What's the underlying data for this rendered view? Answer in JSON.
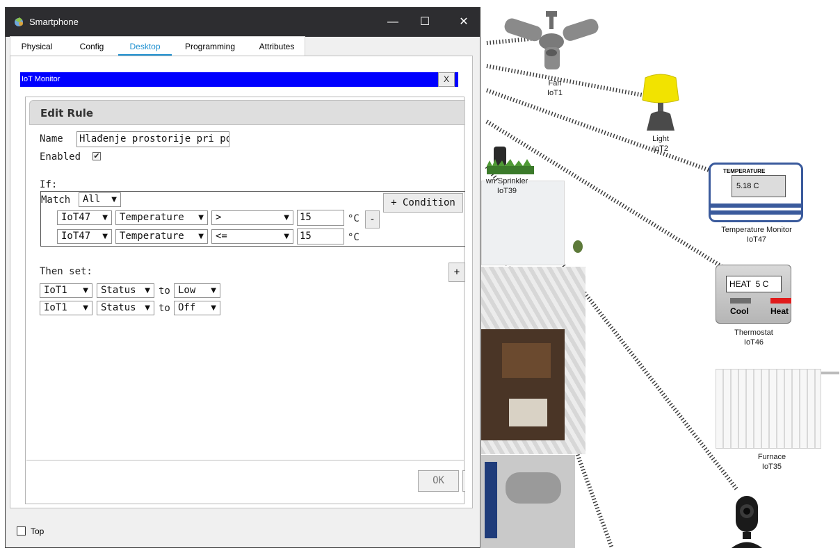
{
  "window": {
    "title": "Smartphone",
    "controls": {
      "minimize": "—",
      "maximize": "☐",
      "close": "✕"
    }
  },
  "tabs": [
    {
      "label": "Physical",
      "active": false
    },
    {
      "label": "Config",
      "active": false
    },
    {
      "label": "Desktop",
      "active": true
    },
    {
      "label": "Programming",
      "active": false
    },
    {
      "label": "Attributes",
      "active": false
    }
  ],
  "iot_monitor": {
    "title": "IoT Monitor",
    "close": "X"
  },
  "edit_rule": {
    "title": "Edit Rule",
    "name_label": "Name",
    "name_value": "Hlađenje prostorije pri povi",
    "enabled_label": "Enabled",
    "enabled": true,
    "if_label": "If:",
    "match_label": "Match",
    "match_value": "All",
    "add_condition": "+ Condition",
    "conditions": [
      {
        "device": "IoT47",
        "property": "Temperature",
        "operator": ">",
        "value": "15",
        "unit": "°C",
        "remove": "-"
      },
      {
        "device": "IoT47",
        "property": "Temperature",
        "operator": "<=",
        "value": "15",
        "unit": "°C"
      }
    ],
    "then_label": "Then set:",
    "add_action": "+",
    "actions": [
      {
        "device": "IoT1",
        "property": "Status",
        "to": "to",
        "value": "Low"
      },
      {
        "device": "IoT1",
        "property": "Status",
        "to": "to",
        "value": "Off"
      }
    ],
    "ok": "OK"
  },
  "footer": {
    "top_label": "Top",
    "top_checked": false
  },
  "workspace": {
    "devices": [
      {
        "name": "Fan",
        "id": "IoT1"
      },
      {
        "name": "Light",
        "id": "IoT2"
      },
      {
        "name": "wn Sprinkler",
        "id": "IoT39"
      },
      {
        "name": "Temperature Monitor",
        "id": "IoT47",
        "screen_title": "TEMPERATURE",
        "reading": "5.18 C"
      },
      {
        "name": "Thermostat",
        "id": "IoT46",
        "display": "HEAT  5 C",
        "cool": "Cool",
        "heat": "Heat"
      },
      {
        "name": "Furnace",
        "id": "IoT35"
      }
    ]
  },
  "colors": {
    "titlebar": "#2d2d30",
    "iot_bar": "#0000ff",
    "tab_active": "#1e90d0",
    "furnace_heat": "#e01b1b"
  }
}
